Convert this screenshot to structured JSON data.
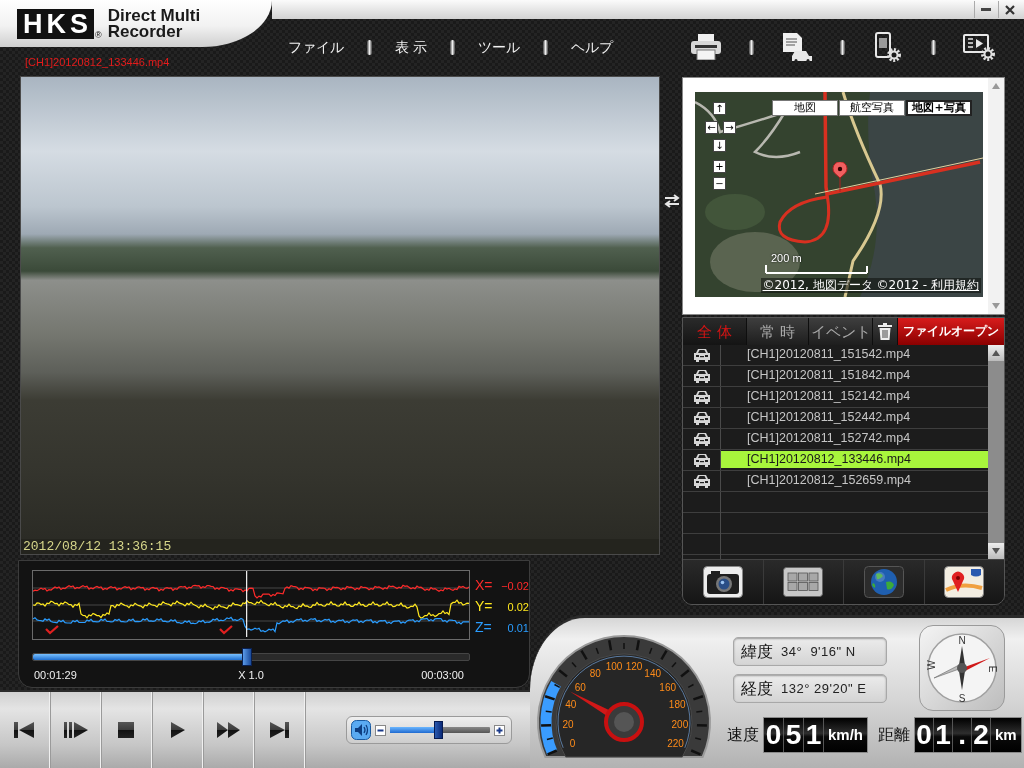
{
  "window": {
    "brand": "HKS",
    "brand_mark": "®",
    "product": [
      "Direct Multi",
      "Recorder"
    ]
  },
  "menu": [
    "ファイル",
    "表 示",
    "ツール",
    "ヘルプ"
  ],
  "current_file": "[CH1]20120812_133446.mp4",
  "video": {
    "timestamp": "2012/08/12 13:36:15"
  },
  "graph": {
    "axes": [
      {
        "label": "X=",
        "reading": "−0.02",
        "color": "#ff2a2a"
      },
      {
        "label": "Y=",
        "reading": "0.02",
        "color": "#ffe81f"
      },
      {
        "label": "Z=",
        "reading": "0.01",
        "color": "#2a9dff"
      }
    ]
  },
  "playback": {
    "level": 0.49,
    "elapsed": "00:01:29",
    "rate": "X 1.0",
    "duration": "00:03:00"
  },
  "volume": {
    "level": 0.48
  },
  "map": {
    "map_types": [
      {
        "label": "地図",
        "selected": false
      },
      {
        "label": "航空写真",
        "selected": false
      },
      {
        "label": "地図+写真",
        "selected": true
      }
    ],
    "nav_controls": [
      "↑",
      "←",
      "→",
      "↓",
      "+",
      "−"
    ],
    "scale": "200 m",
    "attribution": "©2012, 地図データ ©2012 - 利用規約"
  },
  "file_tabs": [
    {
      "label": "全 体",
      "selected": true
    },
    {
      "label": "常 時",
      "selected": false
    },
    {
      "label": "イベント",
      "selected": false
    }
  ],
  "open_file_button": "ファイルオープン",
  "files": [
    {
      "name": "[CH1]20120811_151542.mp4",
      "selected": false
    },
    {
      "name": "[CH1]20120811_151842.mp4",
      "selected": false
    },
    {
      "name": "[CH1]20120811_152142.mp4",
      "selected": false
    },
    {
      "name": "[CH1]20120811_152442.mp4",
      "selected": false
    },
    {
      "name": "[CH1]20120811_152742.mp4",
      "selected": false
    },
    {
      "name": "[CH1]20120812_133446.mp4",
      "selected": true
    },
    {
      "name": "[CH1]20120812_152659.mp4",
      "selected": false
    }
  ],
  "gauge": {
    "ticks": [
      "100",
      "120",
      "80",
      "140",
      "60",
      "160",
      "40",
      "180",
      "20",
      "200",
      "0",
      "220"
    ]
  },
  "coordinates": [
    {
      "label": "緯度",
      "value": "34°  9'16\" N"
    },
    {
      "label": "経度",
      "value": "132° 29'20\" E"
    }
  ],
  "compass": [
    "N",
    "E",
    "S",
    "W"
  ],
  "speed": {
    "label": "速度",
    "digits": [
      "0",
      "5",
      "1"
    ],
    "unit": "km/h"
  },
  "distance": {
    "label": "距離",
    "digits": [
      "0",
      "1",
      ".",
      "2"
    ],
    "unit": "km"
  }
}
